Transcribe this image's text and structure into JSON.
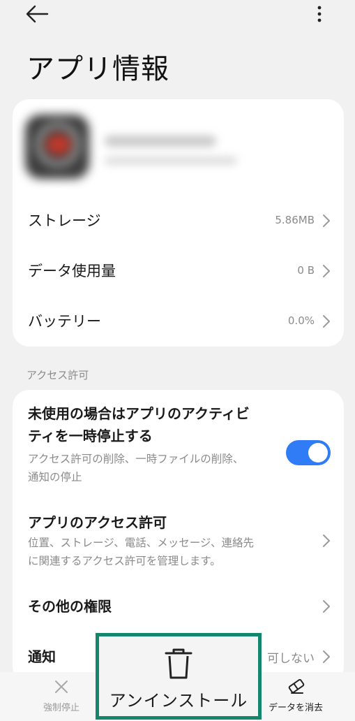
{
  "header": {
    "title": "アプリ情報",
    "back_icon": "arrow-left-icon",
    "more_icon": "more-vertical-icon"
  },
  "app_info": {
    "rows": [
      {
        "label": "ストレージ",
        "value": "5.86MB"
      },
      {
        "label": "データ使用量",
        "value": "0 B"
      },
      {
        "label": "バッテリー",
        "value": "0.0%"
      }
    ]
  },
  "permissions": {
    "section_label": "アクセス許可",
    "pause_activity": {
      "title_line1": "未使用の場合はアプリのアクティビ",
      "title_line2": "ティを一時停止する",
      "sub_line1": "アクセス許可の削除、一時ファイルの削除、",
      "sub_line2": "通知の停止",
      "enabled": true
    },
    "app_permissions": {
      "title": "アプリのアクセス許可",
      "sub_line1": "位置、ストレージ、電話、メッセージ、連絡先",
      "sub_line2": "に関連するアクセス許可を管理します。"
    },
    "other_permissions": {
      "title": "その他の権限"
    },
    "notifications": {
      "title": "通知",
      "value": "可しない"
    }
  },
  "bottom_bar": {
    "force_stop": "強制停止",
    "uninstall": "アンインストール",
    "clear_data": "データを消去"
  },
  "colors": {
    "accent": "#2f7cf6",
    "highlight_border": "#16856e"
  }
}
